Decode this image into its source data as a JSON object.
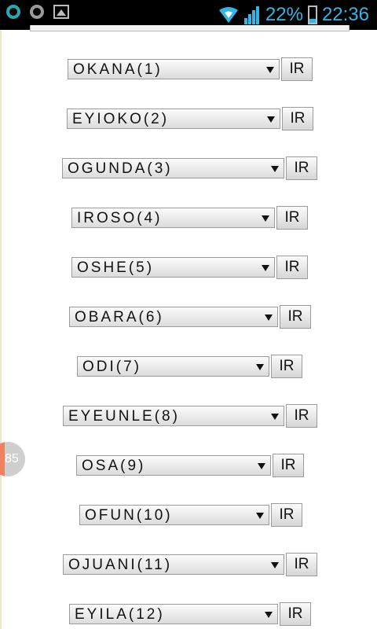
{
  "status_bar": {
    "battery_percent": "22%",
    "time": "22:36",
    "icons": [
      "ring-teal-icon",
      "ring-gray-icon",
      "image-icon",
      "wifi-icon",
      "signal-icon",
      "battery-icon"
    ]
  },
  "side_badge": {
    "text": "85"
  },
  "rows": [
    {
      "select": "OKANA(1)",
      "button": "IR"
    },
    {
      "select": "EYIOKO(2)",
      "button": "IR"
    },
    {
      "select": "OGUNDA(3)",
      "button": "IR"
    },
    {
      "select": "IROSO(4)",
      "button": "IR"
    },
    {
      "select": "OSHE(5)",
      "button": "IR"
    },
    {
      "select": "OBARA(6)",
      "button": "IR"
    },
    {
      "select": "ODI(7)",
      "button": "IR"
    },
    {
      "select": "EYEUNLE(8)",
      "button": "IR"
    },
    {
      "select": "OSA(9)",
      "button": "IR"
    },
    {
      "select": "OFUN(10)",
      "button": "IR"
    },
    {
      "select": "OJUANI(11)",
      "button": "IR"
    },
    {
      "select": "EYILA(12)",
      "button": "IR"
    }
  ]
}
